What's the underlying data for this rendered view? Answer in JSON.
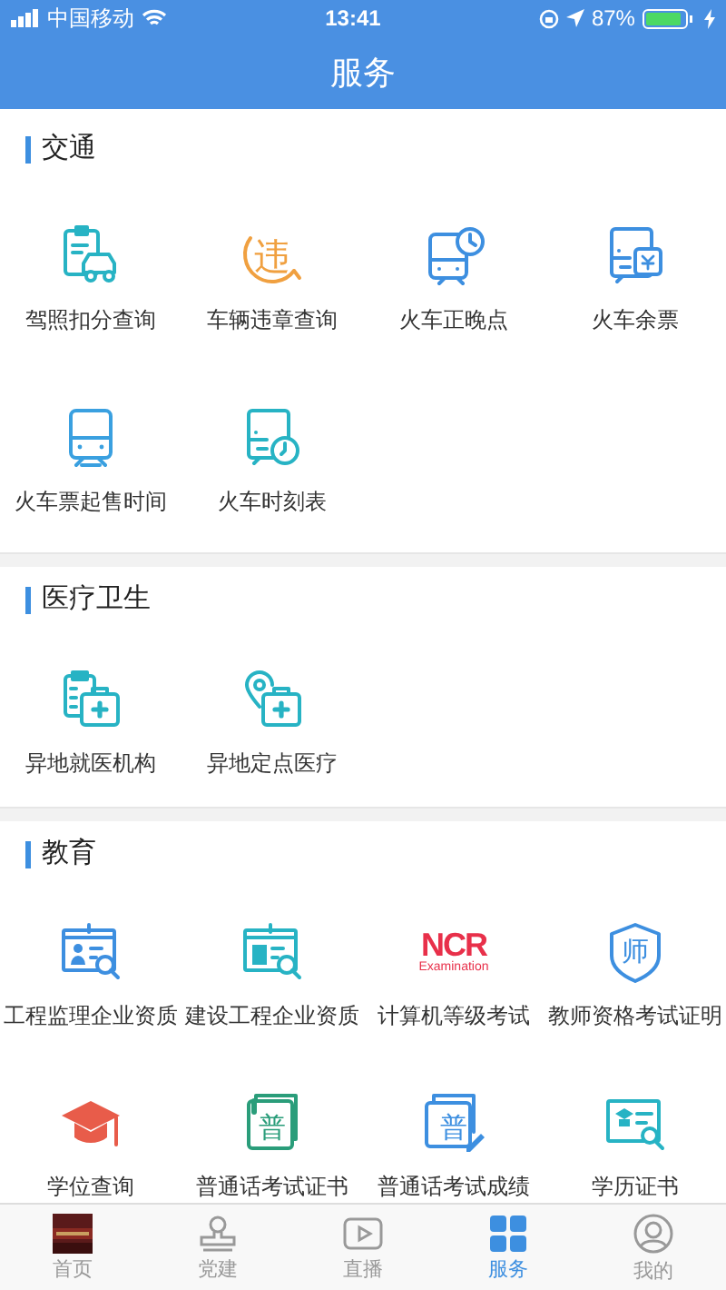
{
  "status_bar": {
    "carrier": "中国移动",
    "time": "13:41",
    "battery": "87%"
  },
  "header": {
    "title": "服务"
  },
  "sections": [
    {
      "title": "交通",
      "items": [
        {
          "label": "驾照扣分查询"
        },
        {
          "label": "车辆违章查询",
          "icon_text": "违"
        },
        {
          "label": "火车正晚点"
        },
        {
          "label": "火车余票"
        },
        {
          "label": "火车票起售时间"
        },
        {
          "label": "火车时刻表"
        }
      ]
    },
    {
      "title": "医疗卫生",
      "items": [
        {
          "label": "异地就医机构"
        },
        {
          "label": "异地定点医疗"
        }
      ]
    },
    {
      "title": "教育",
      "items": [
        {
          "label": "工程监理企业资质"
        },
        {
          "label": "建设工程企业资质"
        },
        {
          "label": "计算机等级考试",
          "icon_text": "NCR",
          "icon_subtext": "Examination"
        },
        {
          "label": "教师资格考试证明",
          "icon_text": "师"
        },
        {
          "label": "学位查询"
        },
        {
          "label": "普通话考试证书",
          "icon_text": "普"
        },
        {
          "label": "普通话考试成绩",
          "icon_text": "普"
        },
        {
          "label": "学历证书"
        }
      ]
    }
  ],
  "tab_bar": [
    {
      "label": "首页",
      "selected": false
    },
    {
      "label": "党建",
      "selected": false
    },
    {
      "label": "直播",
      "selected": false
    },
    {
      "label": "服务",
      "selected": true
    },
    {
      "label": "我的",
      "selected": false
    }
  ]
}
